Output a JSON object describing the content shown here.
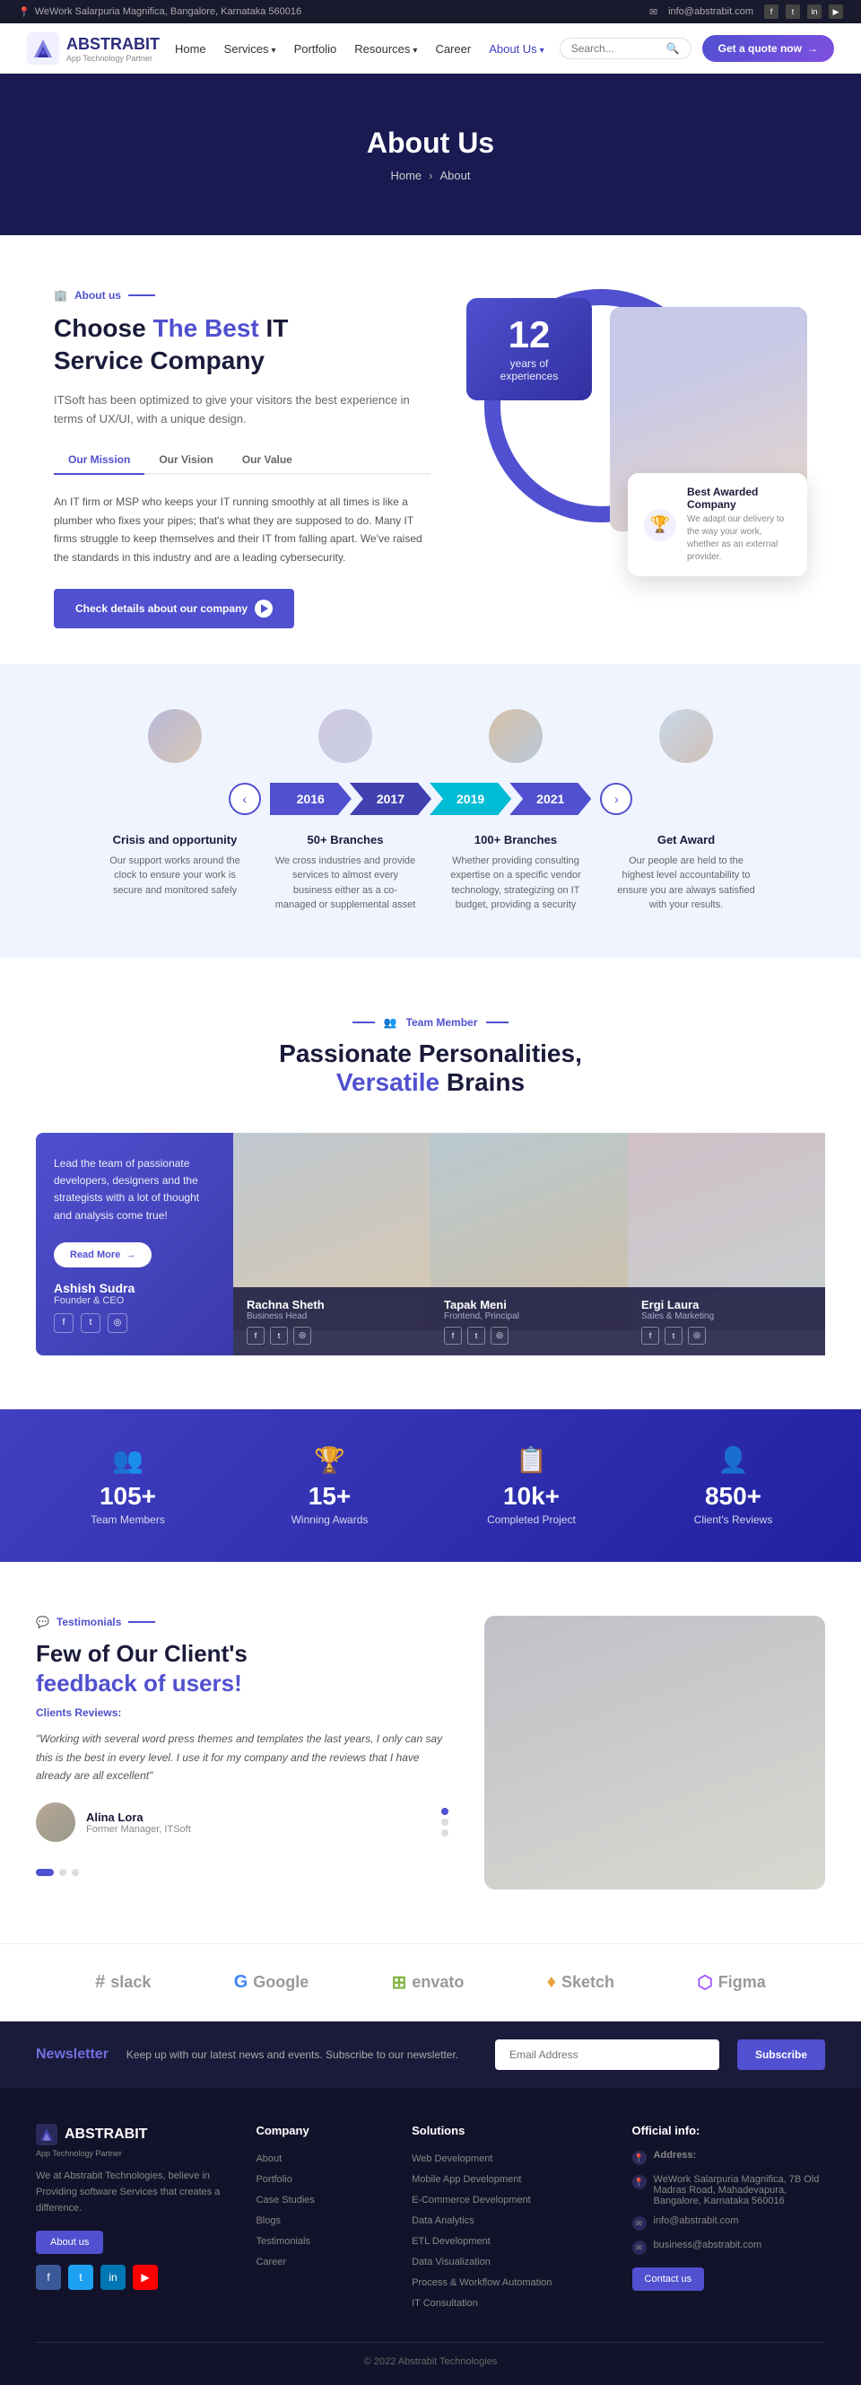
{
  "topbar": {
    "address": "WeWork Salarpuria Magnifica, Bangalore, Karnataka 560016",
    "email": "info@abstrabit.com",
    "address_icon": "📍",
    "email_icon": "✉"
  },
  "navbar": {
    "logo_text": "ABSTRABIT",
    "logo_sub": "App Technology Partner",
    "nav_links": [
      {
        "label": "Home",
        "active": false
      },
      {
        "label": "Services",
        "active": false,
        "has_dropdown": true
      },
      {
        "label": "Portfolio",
        "active": false
      },
      {
        "label": "Resources",
        "active": false,
        "has_dropdown": true
      },
      {
        "label": "Career",
        "active": false
      },
      {
        "label": "About Us",
        "active": true,
        "has_dropdown": true
      }
    ],
    "search_placeholder": "Search...",
    "quote_btn": "Get a quote now"
  },
  "hero": {
    "title": "About Us",
    "breadcrumb_home": "Home",
    "breadcrumb_sep": ">",
    "breadcrumb_current": "About"
  },
  "about": {
    "badge": "About us",
    "heading_line1": "Choose ",
    "heading_highlight1": "The Best",
    "heading_line2": " IT",
    "heading_line3": "Service Company",
    "description": "ITSoft has been optimized to give your visitors the best experience in terms of UX/UI, with a unique design.",
    "tabs": [
      {
        "label": "Our Mission",
        "active": true
      },
      {
        "label": "Our Vision",
        "active": false
      },
      {
        "label": "Our Value",
        "active": false
      }
    ],
    "tab_content": "An IT firm or MSP who keeps your IT running smoothly at all times is like a plumber who fixes your pipes; that's what they are supposed to do. Many IT firms struggle to keep themselves and their IT from falling apart. We've raised the standards in this industry and are a leading cybersecurity.",
    "check_btn": "Check details about our company",
    "years_number": "12",
    "years_text": "years of experiences",
    "award_title": "Best Awarded Company",
    "award_desc": "We adapt our delivery to the way your work, whether as an external provider."
  },
  "timeline": {
    "nav_prev": "‹",
    "nav_next": "›",
    "years": [
      {
        "year": "2016",
        "color": "ty-2016"
      },
      {
        "year": "2017",
        "color": "ty-2017"
      },
      {
        "year": "2019",
        "color": "ty-2019"
      },
      {
        "year": "2021",
        "color": "ty-2021"
      }
    ],
    "items": [
      {
        "year": "2016",
        "title": "Crisis and opportunity",
        "desc": "Our support works around the clock to ensure your work is secure and monitored safely"
      },
      {
        "year": "2017",
        "title": "50+ Branches",
        "desc": "We cross industries and provide services to almost every business either as a co-managed or supplemental asset"
      },
      {
        "year": "2019",
        "title": "100+ Branches",
        "desc": "Whether providing consulting expertise on a specific vendor technology, strategizing on IT budget, providing a security"
      },
      {
        "year": "2021",
        "title": "Get Award",
        "desc": "Our people are held to the highest level accountability to ensure you are always satisfied with your results."
      }
    ]
  },
  "team": {
    "badge": "Team Member",
    "heading_line1": "Passionate Personalities,",
    "heading_line2": "Versatile",
    "heading_line3": " Brains",
    "first_card_text": "Lead the team of passionate developers, designers and the strategists with a lot of thought and analysis come true!",
    "read_more": "Read More",
    "members": [
      {
        "name": "Ashish Sudra",
        "role": "Founder & CEO",
        "is_first": true
      },
      {
        "name": "Rachna Sheth",
        "role": "Business Head"
      },
      {
        "name": "Tapak Meni",
        "role": "Frontend, Principal"
      },
      {
        "name": "Ergi Laura",
        "role": "Sales & Marketing"
      }
    ]
  },
  "stats": [
    {
      "icon": "👥",
      "number": "105+",
      "label": "Team Members"
    },
    {
      "icon": "🏆",
      "number": "15+",
      "label": "Winning Awards"
    },
    {
      "icon": "📋",
      "number": "10k+",
      "label": "Completed Project"
    },
    {
      "icon": "👤",
      "number": "850+",
      "label": "Client's Reviews"
    }
  ],
  "testimonials": {
    "badge": "Testimonials",
    "heading": "Few of Our Client's",
    "heading_highlight": "feedback of users!",
    "clients_label": "Clients Reviews:",
    "quote": "\"Working with several word press themes and templates the last years, I only can say this is the best in every level. I use it for my company and the reviews that I have already are all excellent\"",
    "author_name": "Alina Lora",
    "author_role": "Former Manager, ITSoft"
  },
  "clients": [
    {
      "name": "slack",
      "icon": "#"
    },
    {
      "name": "Google",
      "icon": "G"
    },
    {
      "name": "envato",
      "icon": "⊞"
    },
    {
      "name": "Sketch",
      "icon": "♦"
    },
    {
      "name": "Figma",
      "icon": "⬡"
    }
  ],
  "newsletter": {
    "label": "Newsletter",
    "description": "Keep up with our latest news and events. Subscribe to our newsletter.",
    "placeholder": "Email Address",
    "subscribe_btn": "Subscribe"
  },
  "footer": {
    "brand_name": "ABSTRABIT",
    "brand_sub": "App Technology Partner",
    "brand_desc": "We at Abstrabit Technologies, believe in Providing software Services that creates a difference.",
    "about_btn": "About us",
    "columns": {
      "company": {
        "title": "Company",
        "links": [
          "About",
          "Portfolio",
          "Case Studies",
          "Blogs",
          "Testimonials",
          "Career"
        ]
      },
      "solutions": {
        "title": "Solutions",
        "links": [
          "Web Development",
          "Mobile App Development",
          "E-Commerce Development",
          "Data Analytics",
          "ETL Development",
          "Data Visualization",
          "Process & Workflow Automation",
          "IT Consultation"
        ]
      },
      "official": {
        "title": "Official info:",
        "address_label": "Address:",
        "address": "WeWork Salarpuria Magnifica, 7B Old Madras Road, Mahadevapura, Bangalore, Karnataka 560016",
        "email1": "info@abstrabit.com",
        "email2": "business@abstrabit.com",
        "contact_btn": "Contact us"
      }
    },
    "copyright": "© 2022 Abstrabit Technologies"
  }
}
